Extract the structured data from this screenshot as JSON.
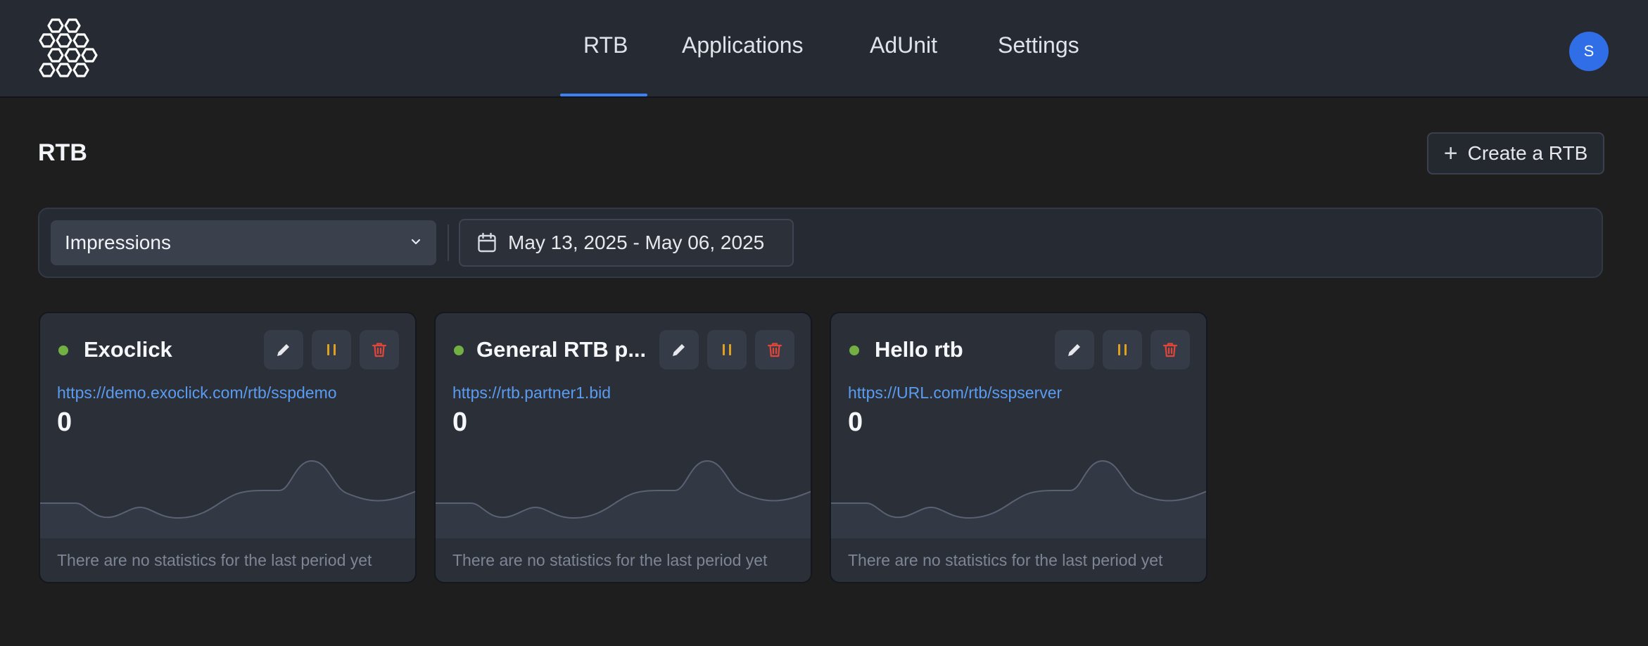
{
  "nav": {
    "items": [
      {
        "label": "RTB",
        "active": true
      },
      {
        "label": "Applications"
      },
      {
        "label": "AdUnit"
      },
      {
        "label": "Settings"
      }
    ],
    "avatar_initial": "S",
    "logo_icon": "hexagon-cluster-logo"
  },
  "page": {
    "title": "RTB",
    "create_label": "Create a RTB"
  },
  "filters": {
    "metric_selected": "Impressions",
    "date_range": "May 13, 2025 - May 06, 2025"
  },
  "cards": [
    {
      "name": "Exoclick",
      "url": "https://demo.exoclick.com/rtb/sspdemo",
      "value": "0",
      "note": "There are no statistics for the last period yet",
      "status": "active"
    },
    {
      "name": "General RTB p...",
      "url": "https://rtb.partner1.bid",
      "value": "0",
      "note": "There are no statistics for the last period yet",
      "status": "active"
    },
    {
      "name": "Hello rtb",
      "url": "https://URL.com/rtb/sspserver",
      "value": "0",
      "note": "There are no statistics for the last period yet",
      "status": "active"
    }
  ],
  "colors": {
    "accent": "#3b82f6",
    "status_active": "#72b043",
    "pause": "#e0a020",
    "delete": "#e0453a",
    "link": "#5b9bf0"
  }
}
